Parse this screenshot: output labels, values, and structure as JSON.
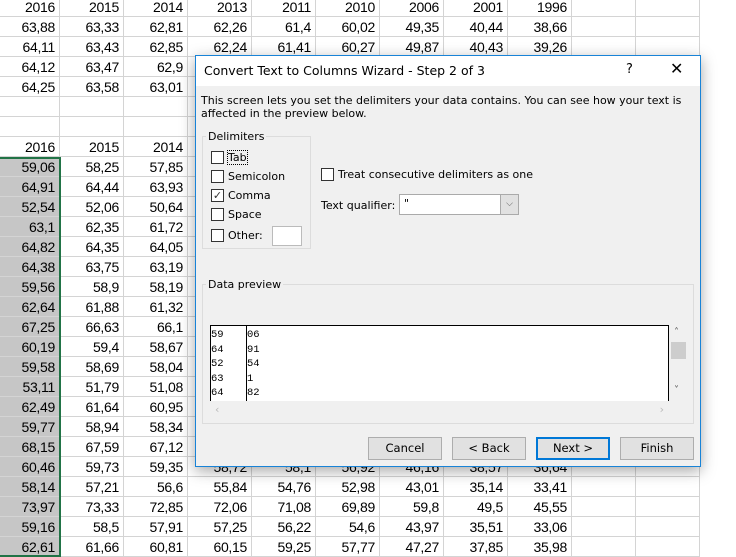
{
  "sheet": {
    "top_header": [
      "2016",
      "2015",
      "2014",
      "2013",
      "2011",
      "2010",
      "2006",
      "2001",
      "1996"
    ],
    "top_rows": [
      [
        "63,88",
        "63,33",
        "62,81",
        "62,26",
        "61,4",
        "60,02",
        "49,35",
        "40,44",
        "38,66"
      ],
      [
        "64,11",
        "63,43",
        "62,85",
        "62,24",
        "61,41",
        "60,27",
        "49,87",
        "40,43",
        "39,26"
      ],
      [
        "64,12",
        "63,47",
        "62,9"
      ],
      [
        "64,25",
        "63,58",
        "63,01"
      ]
    ],
    "bottom_header": [
      "2016",
      "2015",
      "2014"
    ],
    "bottom_rows": [
      [
        "59,06",
        "58,25",
        "57,85"
      ],
      [
        "64,91",
        "64,44",
        "63,93"
      ],
      [
        "52,54",
        "52,06",
        "50,64"
      ],
      [
        "63,1",
        "62,35",
        "61,72"
      ],
      [
        "64,82",
        "64,35",
        "64,05"
      ],
      [
        "64,38",
        "63,75",
        "63,19"
      ],
      [
        "59,56",
        "58,9",
        "58,19"
      ],
      [
        "62,64",
        "61,88",
        "61,32"
      ],
      [
        "67,25",
        "66,63",
        "66,1"
      ],
      [
        "60,19",
        "59,4",
        "58,67"
      ],
      [
        "59,58",
        "58,69",
        "58,04"
      ],
      [
        "53,11",
        "51,79",
        "51,08"
      ],
      [
        "62,49",
        "61,64",
        "60,95"
      ],
      [
        "59,77",
        "58,94",
        "58,34"
      ],
      [
        "68,15",
        "67,59",
        "67,12"
      ],
      [
        "60,46",
        "59,73",
        "59,35",
        "58,72",
        "58,1",
        "56,92",
        "46,16",
        "38,57",
        "36,64"
      ],
      [
        "58,14",
        "57,21",
        "56,6",
        "55,84",
        "54,76",
        "52,98",
        "43,01",
        "35,14",
        "33,41"
      ],
      [
        "73,97",
        "73,33",
        "72,85",
        "72,06",
        "71,08",
        "69,89",
        "59,8",
        "49,5",
        "45,55"
      ],
      [
        "59,16",
        "58,5",
        "57,91",
        "57,25",
        "56,22",
        "54,6",
        "43,97",
        "35,51",
        "33,06"
      ],
      [
        "62,61",
        "61,66",
        "60,81",
        "60,15",
        "59,25",
        "57,77",
        "47,27",
        "37,85",
        "35,98"
      ]
    ],
    "colors": {
      "selection": "#c6c6c6",
      "selection_border": "#217346",
      "gridline": "#d4d4d4"
    }
  },
  "dialog": {
    "title": "Convert Text to Columns Wizard - Step 2 of 3",
    "help": "?",
    "close": "X",
    "description": "This screen lets you set the delimiters your data contains.  You can see how your text is affected in the preview below.",
    "delimiters_label": "Delimiters",
    "delimiters": [
      {
        "label": "Tab",
        "checked": false
      },
      {
        "label": "Semicolon",
        "checked": false
      },
      {
        "label": "Comma",
        "checked": true
      },
      {
        "label": "Space",
        "checked": false
      },
      {
        "label": "Other:",
        "checked": false
      }
    ],
    "other_value": "",
    "treat_consecutive": {
      "label": "Treat consecutive delimiters as one",
      "checked": false
    },
    "text_qualifier": {
      "label": "Text qualifier:",
      "value": "\""
    },
    "preview_label": "Data preview",
    "preview_rows": [
      [
        "59",
        "06"
      ],
      [
        "64",
        "91"
      ],
      [
        "52",
        "54"
      ],
      [
        "63",
        "1"
      ],
      [
        "64",
        "82"
      ]
    ],
    "buttons": {
      "cancel": "Cancel",
      "back": "< Back",
      "next": "Next >",
      "finish": "Finish"
    },
    "colors": {
      "accent": "#0078d7",
      "border": "#1883d7"
    }
  }
}
